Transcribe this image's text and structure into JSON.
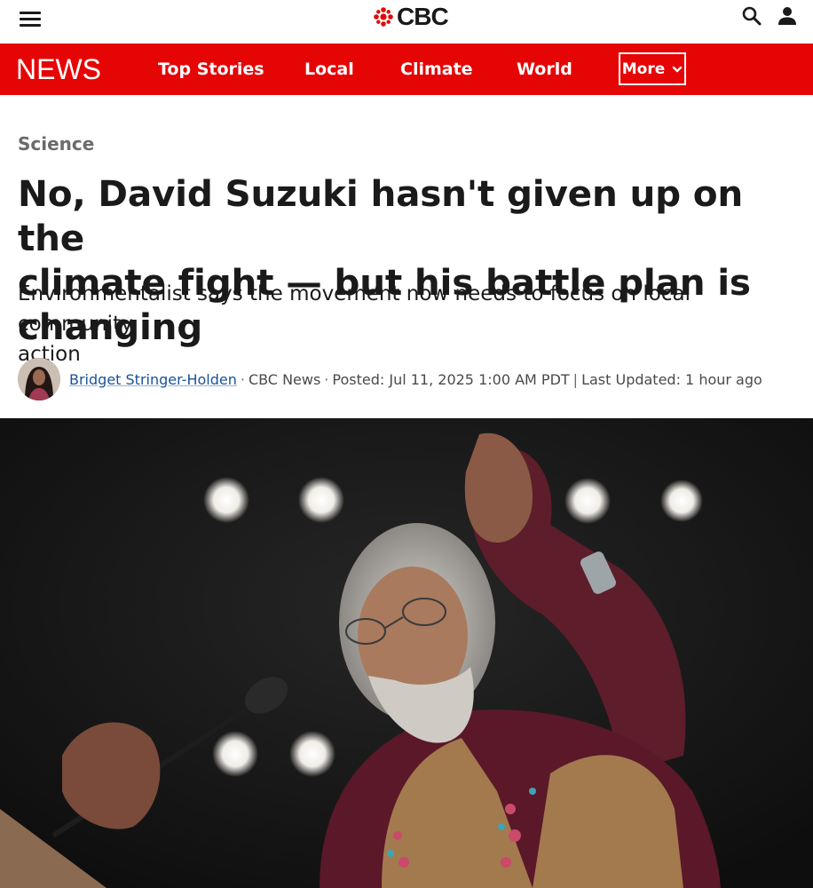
{
  "header": {
    "brand": "CBC",
    "menu_icon": "hamburger-menu-icon",
    "search_icon": "search-icon",
    "account_icon": "user-account-icon"
  },
  "nav": {
    "brand": "NEWS",
    "items": [
      {
        "label": "Top Stories"
      },
      {
        "label": "Local"
      },
      {
        "label": "Climate"
      },
      {
        "label": "World"
      }
    ],
    "more_label": "More",
    "more_icon": "chevron-down-icon"
  },
  "article": {
    "section": "Science",
    "headline_line1": "No, David Suzuki hasn't given up on the",
    "headline_line2": "climate fight — but his battle plan is changing",
    "deck_line1": "Environmentalist says the movement now needs to focus on local community",
    "deck_line2": "action",
    "byline": {
      "author": "Bridget Stringer-Holden",
      "outlet": "CBC News",
      "posted": "Posted: Jul 11, 2025 1:00 AM PDT",
      "updated": "Last Updated: 1 hour ago"
    }
  },
  "colors": {
    "brand_red": "#e60505",
    "text": "#1a1a1a",
    "link": "#1a5296",
    "muted": "#6b6b6b"
  }
}
